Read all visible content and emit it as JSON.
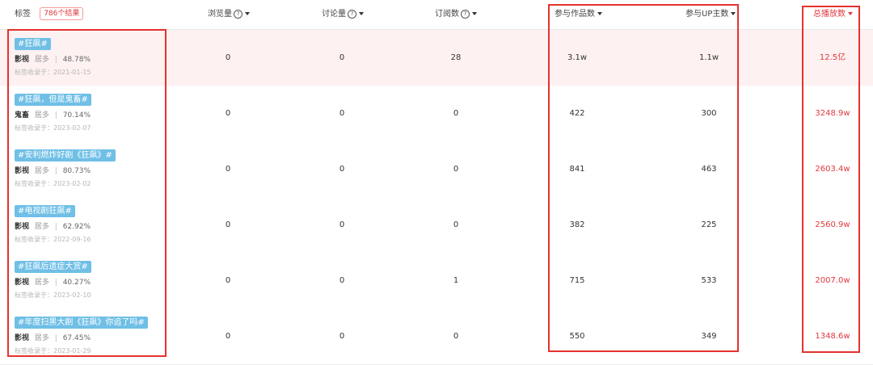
{
  "header": {
    "tag_label": "标签",
    "result_count": "786个结果",
    "columns": {
      "views": "浏览量",
      "discussions": "讨论量",
      "subscriptions": "订阅数",
      "works": "参与作品数",
      "up_owners": "参与UP主数",
      "total_plays": "总播放数"
    },
    "help_glyph": "?"
  },
  "rows": [
    {
      "tag": "#狂飙#",
      "category": "影视",
      "share_label": "居多",
      "share": "48.78%",
      "date_label": "标签收录于：",
      "date": "2021-01-15",
      "views": "0",
      "discussions": "0",
      "subscriptions": "28",
      "works": "3.1w",
      "up_owners": "1.1w",
      "total_plays": "12.5亿"
    },
    {
      "tag": "#狂飙，但是鬼畜#",
      "category": "鬼畜",
      "share_label": "居多",
      "share": "70.14%",
      "date_label": "标签收录于：",
      "date": "2023-02-07",
      "views": "0",
      "discussions": "0",
      "subscriptions": "0",
      "works": "422",
      "up_owners": "300",
      "total_plays": "3248.9w"
    },
    {
      "tag": "#安利燃炸好剧《狂飙》#",
      "category": "影视",
      "share_label": "居多",
      "share": "80.73%",
      "date_label": "标签收录于：",
      "date": "2023-02-02",
      "views": "0",
      "discussions": "0",
      "subscriptions": "0",
      "works": "841",
      "up_owners": "463",
      "total_plays": "2603.4w"
    },
    {
      "tag": "#电视剧狂飙#",
      "category": "影视",
      "share_label": "居多",
      "share": "62.92%",
      "date_label": "标签收录于：",
      "date": "2022-09-16",
      "views": "0",
      "discussions": "0",
      "subscriptions": "0",
      "works": "382",
      "up_owners": "225",
      "total_plays": "2560.9w"
    },
    {
      "tag": "#狂飙后遗症大赏#",
      "category": "影视",
      "share_label": "居多",
      "share": "40.27%",
      "date_label": "标签收录于：",
      "date": "2023-02-10",
      "views": "0",
      "discussions": "0",
      "subscriptions": "1",
      "works": "715",
      "up_owners": "533",
      "total_plays": "2007.0w"
    },
    {
      "tag": "#年度扫黑大剧《狂飙》你追了吗#",
      "category": "影视",
      "share_label": "居多",
      "share": "67.45%",
      "date_label": "标签收录于：",
      "date": "2023-01-29",
      "views": "0",
      "discussions": "0",
      "subscriptions": "0",
      "works": "550",
      "up_owners": "349",
      "total_plays": "1348.6w"
    }
  ],
  "colors": {
    "accent_red": "#e0383e",
    "tag_chip": "#6fbfe6",
    "highlight_row": "#fdf1f1",
    "annotation_red": "#e5322f"
  }
}
